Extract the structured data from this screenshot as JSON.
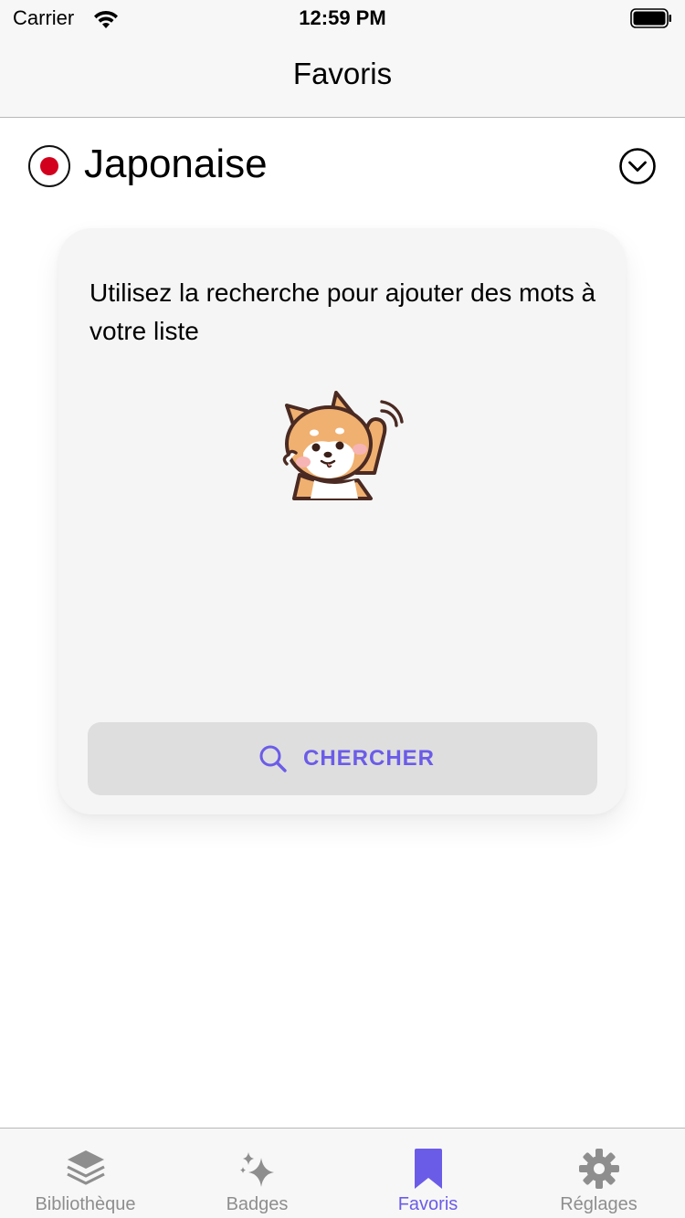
{
  "status_bar": {
    "carrier": "Carrier",
    "time": "12:59 PM"
  },
  "nav": {
    "title": "Favoris"
  },
  "language": {
    "name": "Japonaise",
    "flag_icon": "japan-flag-icon",
    "toggle_icon": "chevron-down-circle-icon"
  },
  "card": {
    "message": "Utilisez la recherche pour ajouter des mots à votre liste",
    "illustration": "shiba-dog-waving",
    "search_button_label": "CHERCHER",
    "search_icon": "search-icon"
  },
  "tabs": [
    {
      "label": "Bibliothèque",
      "icon": "layers-icon",
      "active": false
    },
    {
      "label": "Badges",
      "icon": "sparkles-icon",
      "active": false
    },
    {
      "label": "Favoris",
      "icon": "bookmark-icon",
      "active": true
    },
    {
      "label": "Réglages",
      "icon": "gear-icon",
      "active": false
    }
  ],
  "colors": {
    "accent": "#6b5ce8",
    "inactive": "#8e8e8e",
    "flag_red": "#d3001d",
    "card_bg": "#f5f5f5",
    "button_bg": "#dedede"
  }
}
